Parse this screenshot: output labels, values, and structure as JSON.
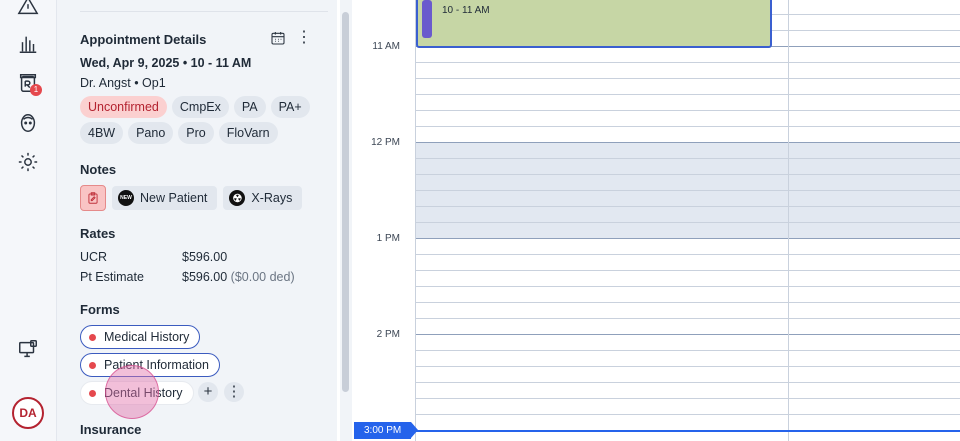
{
  "nav": {
    "badge_count": "1",
    "avatar_initials": "DA"
  },
  "appointment": {
    "section_title": "Appointment Details",
    "date_time": "Wed, Apr 9, 2025 • 10 - 11 AM",
    "provider": "Dr. Angst • Op1",
    "tags_row1": [
      "Unconfirmed",
      "CmpEx",
      "PA",
      "PA+"
    ],
    "tags_row2": [
      "4BW",
      "Pano",
      "Pro",
      "FloVarn"
    ]
  },
  "notes": {
    "title": "Notes",
    "items": [
      "New Patient",
      "X-Rays"
    ],
    "new_badge": "NEW"
  },
  "rates": {
    "title": "Rates",
    "ucr_label": "UCR",
    "ucr_value": "$596.00",
    "pt_label": "Pt Estimate",
    "pt_value": "$596.00",
    "pt_ded": "($0.00 ded)"
  },
  "forms": {
    "title": "Forms",
    "items": [
      "Medical History",
      "Patient Information",
      "Dental History"
    ],
    "add_label": "+",
    "more_label": "⋮"
  },
  "insurance": {
    "title": "Insurance"
  },
  "calendar": {
    "times": [
      "11 AM",
      "12 PM",
      "1 PM",
      "2 PM"
    ],
    "appointment_time": "10 - 11 AM",
    "now_label": "3:00 PM"
  },
  "colors": {
    "accent": "#2563eb",
    "appointment_fill": "#c6d6a5",
    "unconfirmed": "#fbd0d0"
  }
}
